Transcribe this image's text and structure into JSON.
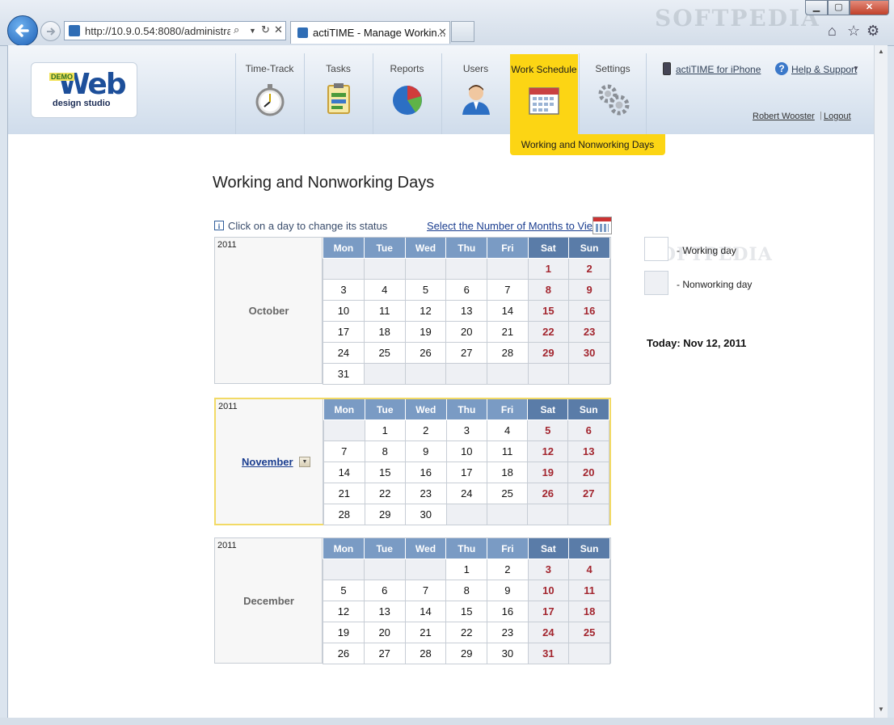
{
  "browser": {
    "address": "http://10.9.0.54:8080/administratic",
    "tab_title": "actiTIME - Manage Workin...",
    "tab_close": "✕",
    "watermark": "SOFTPEDIA"
  },
  "nav": {
    "items": [
      {
        "label": "Time-Track",
        "icon": "stopwatch-icon"
      },
      {
        "label": "Tasks",
        "icon": "clipboard-icon"
      },
      {
        "label": "Reports",
        "icon": "pie-chart-icon"
      },
      {
        "label": "Users",
        "icon": "user-icon"
      },
      {
        "label": "Work Schedule",
        "icon": "calendar-icon"
      },
      {
        "label": "Settings",
        "icon": "gears-icon"
      }
    ],
    "active_sub": "Working and Nonworking Days",
    "iphone_link": "actiTIME for iPhone",
    "help_link": "Help & Support",
    "user_name": "Robert Wooster",
    "separator": "|",
    "logout": "Logout"
  },
  "logo": {
    "demo": "DEMO",
    "web": "Web",
    "sub": "design studio"
  },
  "page": {
    "title": "Working and Nonworking Days",
    "hint": "Click on a day to change its status",
    "months_link": "Select the Number of Months to View"
  },
  "legend": {
    "working": "- Working day",
    "nonworking": "- Nonworking day",
    "today": "Today: Nov 12, 2011",
    "watermark": "SOFTPEDIA"
  },
  "weekdays": [
    "Mon",
    "Tue",
    "Wed",
    "Thu",
    "Fri",
    "Sat",
    "Sun"
  ],
  "months": [
    {
      "year": "2011",
      "name": "October",
      "offset": 5,
      "days": 31,
      "current": false
    },
    {
      "year": "2011",
      "name": "November",
      "offset": 1,
      "days": 30,
      "current": true
    },
    {
      "year": "2011",
      "name": "December",
      "offset": 3,
      "days": 31,
      "current": false
    }
  ],
  "colors": {
    "accent": "#fcd514",
    "weekend_text": "#a3262f",
    "header": "#7a9bc4"
  }
}
